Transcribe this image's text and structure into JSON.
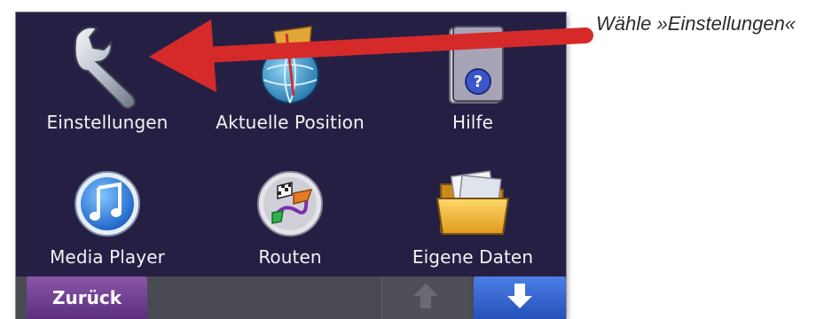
{
  "menu": {
    "settings_label": "Einstellungen",
    "position_label": "Aktuelle Position",
    "help_label": "Hilfe",
    "media_label": "Media Player",
    "routes_label": "Routen",
    "mydata_label": "Eigene Daten"
  },
  "bottom": {
    "back_label": "Zurück"
  },
  "annotation": {
    "caption": "Wähle »Einstellungen«",
    "arrow_color": "#d62a2a"
  },
  "colors": {
    "screen_bg": "#252043",
    "back_button": "#6e3a8e",
    "down_button": "#2e5fcf"
  },
  "icons": [
    "wrench-icon",
    "globe-flag-icon",
    "help-book-icon",
    "music-note-icon",
    "routes-flag-icon",
    "folder-icon",
    "arrow-up-icon",
    "arrow-down-icon"
  ]
}
